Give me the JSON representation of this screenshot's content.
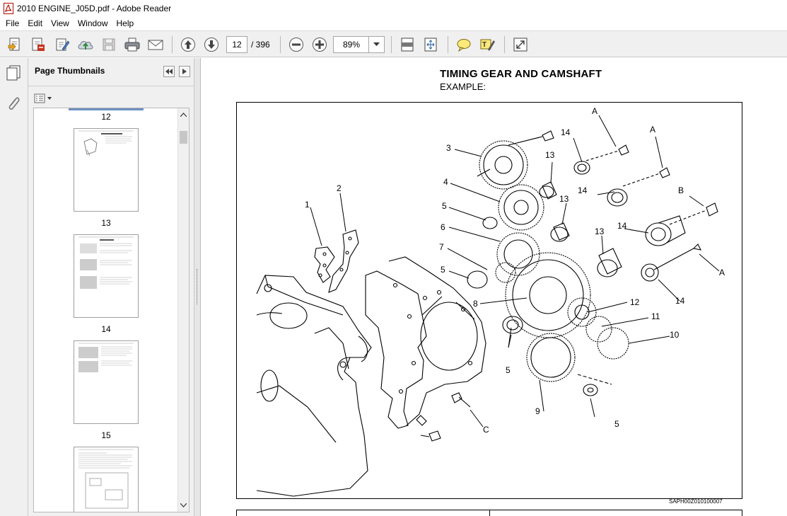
{
  "window": {
    "title": "2010 ENGINE_J05D.pdf - Adobe Reader"
  },
  "menu": [
    "File",
    "Edit",
    "View",
    "Window",
    "Help"
  ],
  "toolbar": {
    "page_current": "12",
    "page_total": "/ 396",
    "zoom": "89%",
    "icons": [
      "create-pdf-icon",
      "convert-icon",
      "sign-icon",
      "upload-icon",
      "save-icon",
      "print-icon",
      "email-icon",
      "previous-page-icon",
      "next-page-icon",
      "zoom-out-icon",
      "zoom-in-icon",
      "fit-page-icon",
      "fit-width-icon",
      "comment-icon",
      "highlight-icon",
      "fullscreen-icon"
    ]
  },
  "thumb_panel": {
    "title": "Page Thumbnails",
    "pages": [
      "12",
      "13",
      "14",
      "15"
    ]
  },
  "document": {
    "title": "TIMING GEAR AND CAMSHAFT",
    "subtitle": "EXAMPLE:",
    "figure_code": "SAPH00Z010100007",
    "table_headers": [
      "",
      ""
    ],
    "callouts": [
      "1",
      "2",
      "3",
      "4",
      "5",
      "6",
      "7",
      "5",
      "8",
      "5",
      "9",
      "5",
      "10",
      "11",
      "12",
      "13",
      "13",
      "13",
      "14",
      "14",
      "14",
      "14",
      "A",
      "A",
      "B",
      "A",
      "C"
    ]
  }
}
